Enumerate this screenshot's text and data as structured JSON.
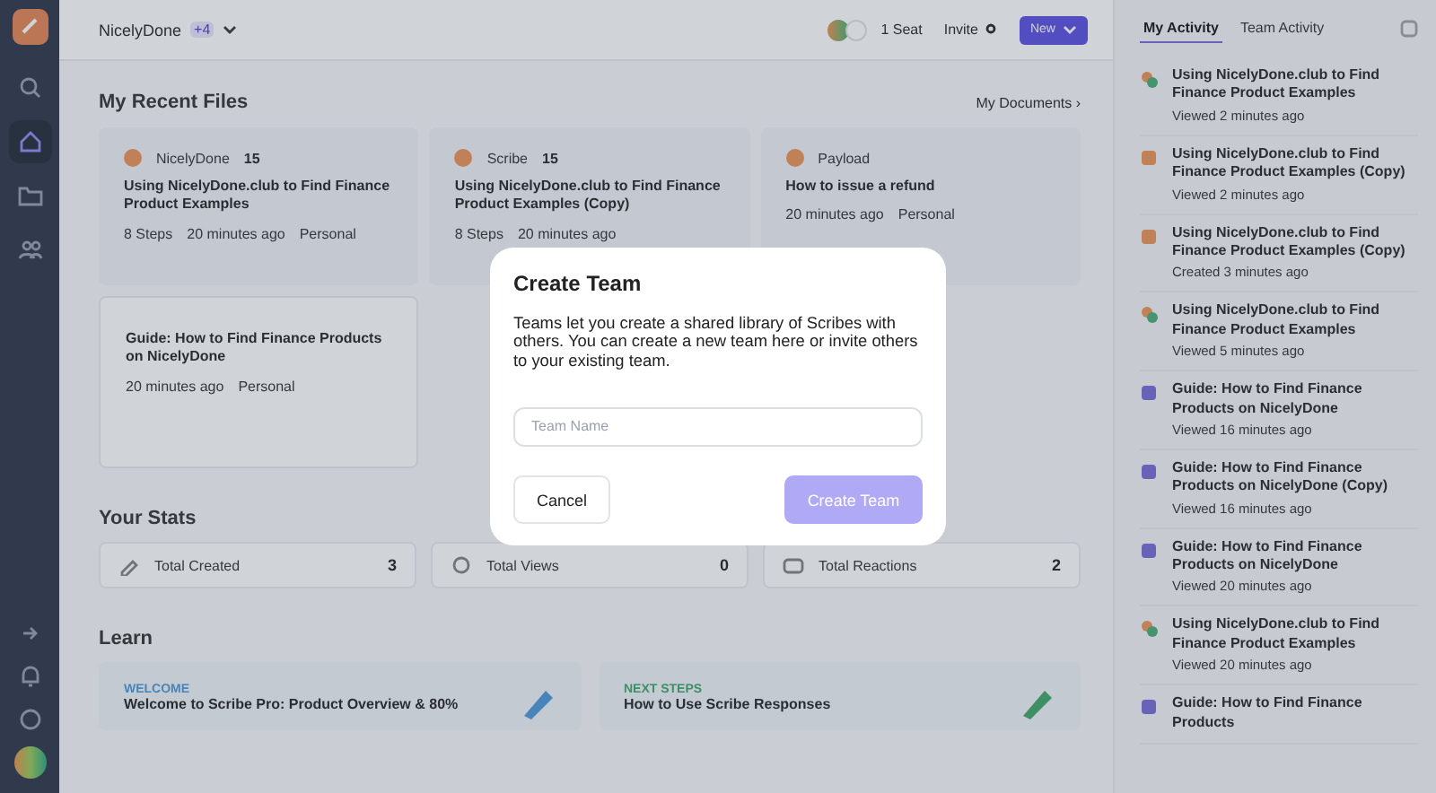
{
  "sidebar": {
    "nav": [
      {
        "selected": false
      },
      {
        "selected": true
      },
      {
        "selected": false
      },
      {
        "selected": false
      }
    ]
  },
  "topbar": {
    "workspace": "NicelyDone",
    "workspace_badge": "+4",
    "seats": "1 Seat",
    "invite": "Invite",
    "new_button": "New"
  },
  "recent_files": {
    "title": "My Recent Files",
    "link": "My Documents ›",
    "cards": [
      {
        "kind": "app",
        "app": "NicelyDone",
        "count": "15",
        "title": "Using NicelyDone.club to Find Finance Product Examples",
        "meta": [
          "8 Steps",
          "20 minutes ago",
          "Personal"
        ]
      },
      {
        "kind": "app",
        "app": "Scribe",
        "count": "15",
        "title": "Using NicelyDone.club to Find Finance Product Examples (Copy)",
        "meta": [
          "8 Steps",
          "20 minutes ago"
        ]
      },
      {
        "kind": "app",
        "app": "Payload",
        "title": "How to issue a refund",
        "meta": [
          "20 minutes ago",
          "Personal"
        ]
      },
      {
        "kind": "guide",
        "title": "Guide: How to Find Finance Products on NicelyDone",
        "meta": [
          "20 minutes ago",
          "Personal"
        ]
      }
    ]
  },
  "stats": {
    "title": "Your Stats",
    "items": [
      {
        "label": "Total Created",
        "value": "3"
      },
      {
        "label": "Total Views",
        "value": "0"
      },
      {
        "label": "Total Reactions",
        "value": "2"
      }
    ]
  },
  "learn": {
    "title": "Learn",
    "cards": [
      {
        "kind": "welcome",
        "tag": "WELCOME",
        "title": "Welcome to Scribe Pro: Product Overview & 80%"
      },
      {
        "kind": "next",
        "tag": "NEXT STEPS",
        "title": "How to Use Scribe Responses"
      }
    ]
  },
  "activity": {
    "tabs": [
      {
        "label": "My Activity",
        "selected": true
      },
      {
        "label": "Team Activity",
        "selected": false
      }
    ],
    "items": [
      {
        "kind": "scribe",
        "title": "Using NicelyDone.club to Find Finance Product Examples",
        "time": "Viewed 2 minutes ago"
      },
      {
        "kind": "copy",
        "title": "Using NicelyDone.club to Find Finance Product Examples (Copy)",
        "time": "Viewed 2 minutes ago"
      },
      {
        "kind": "copy",
        "title": "Using NicelyDone.club to Find Finance Product Examples (Copy)",
        "time": "Created 3 minutes ago"
      },
      {
        "kind": "scribe",
        "title": "Using NicelyDone.club to Find Finance Product Examples",
        "time": "Viewed 5 minutes ago"
      },
      {
        "kind": "guide",
        "title": "Guide: How to Find Finance Products on NicelyDone",
        "time": "Viewed 16 minutes ago"
      },
      {
        "kind": "guide",
        "title": "Guide: How to Find Finance Products on NicelyDone (Copy)",
        "time": "Viewed 16 minutes ago"
      },
      {
        "kind": "guide",
        "title": "Guide: How to Find Finance Products on NicelyDone",
        "time": "Viewed 20 minutes ago"
      },
      {
        "kind": "scribe",
        "title": "Using NicelyDone.club to Find Finance Product Examples",
        "time": "Viewed 20 minutes ago"
      },
      {
        "kind": "guide",
        "title": "Guide: How to Find Finance Products"
      }
    ]
  },
  "dialog": {
    "title": "Create Team",
    "text": "Teams let you create a shared library of Scribes with others. You can create a new team here or invite others to your existing team.",
    "field": {
      "placeholder": "Team Name"
    },
    "cancel": "Cancel",
    "submit": {
      "label": "Create Team",
      "disabled": true
    }
  }
}
